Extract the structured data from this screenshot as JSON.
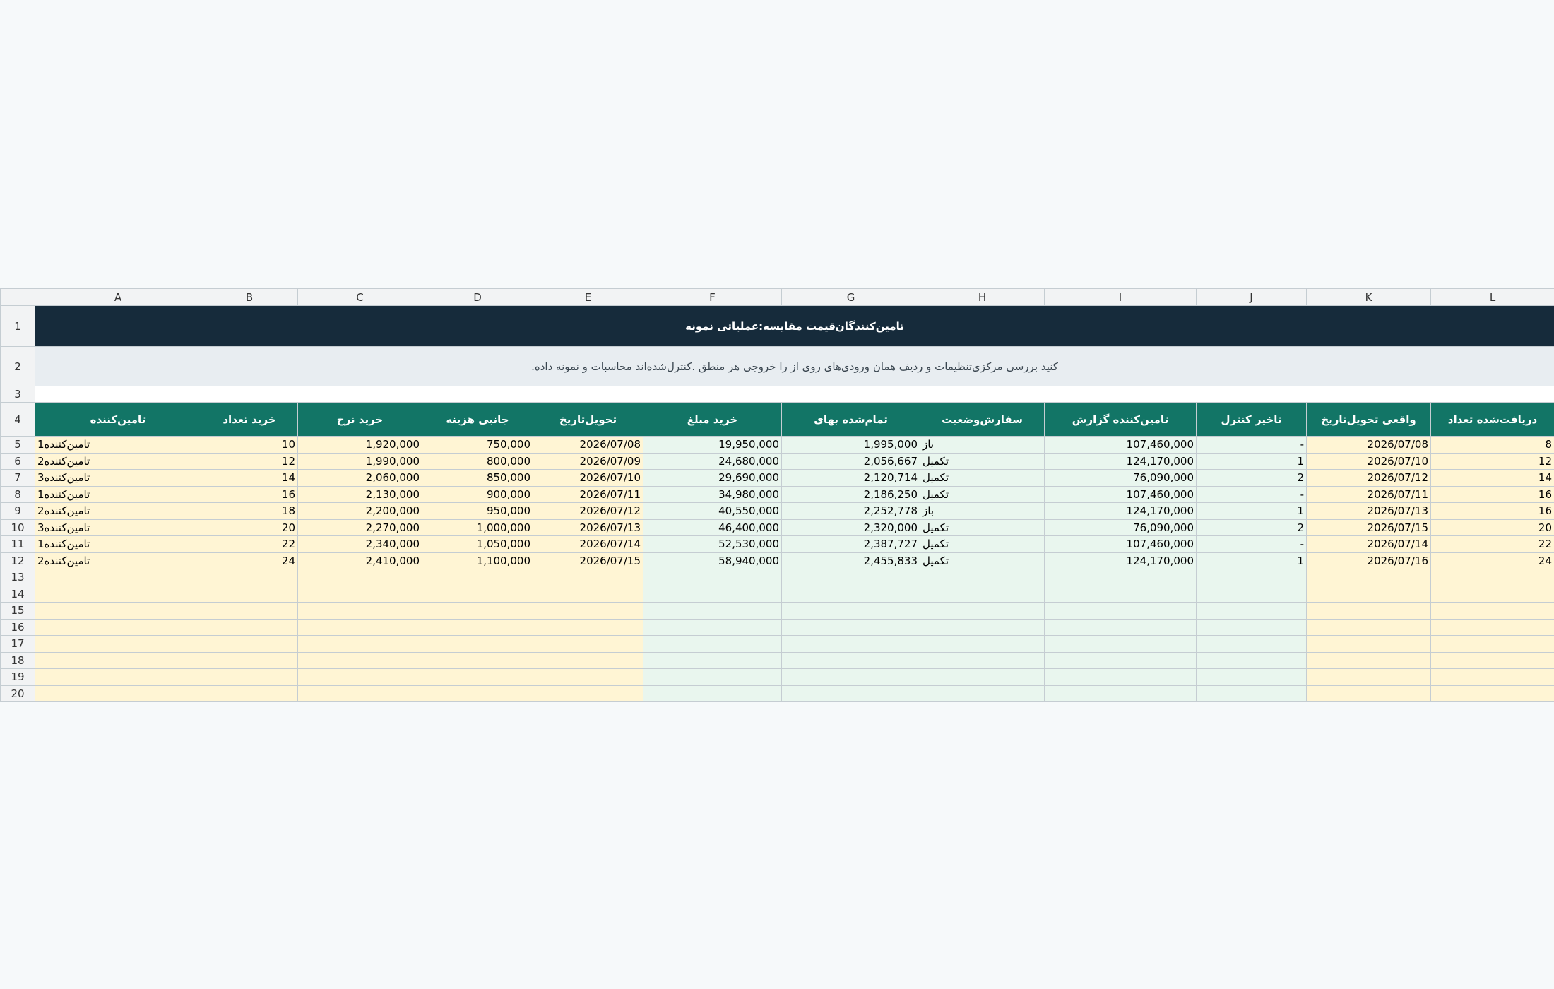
{
  "columns": [
    "A",
    "B",
    "C",
    "D",
    "E",
    "F",
    "G",
    "H",
    "I",
    "J",
    "K",
    "L"
  ],
  "title": "تامین‌کنندگان‌قیمت مقایسه:عملیاتی نمونه",
  "note": ".کنید بررسی مرکزی‌تنظیمات و ردیف همان ورودی‌های روی از را خروجی هر منطق .کنترل‌شده‌اند محاسبات و نمونه داده",
  "headers": [
    "تامین‌کننده",
    "خرید تعداد",
    "خرید نرخ",
    "جانبی هزینه",
    "تحویل‌تاریخ",
    "خرید مبلغ",
    "تمام‌شده بهای",
    "سفارش‌وضعیت",
    "تامین‌کننده گزارش",
    "تاخیر  کنترل",
    "واقعی تحویل‌تاریخ",
    "دریافت‌شده تعداد"
  ],
  "rows": [
    [
      "تامین‌کننده1",
      "10",
      "1,920,000",
      "750,000",
      "2026/07/08",
      "19,950,000",
      "1,995,000",
      "باز",
      "107,460,000",
      "-",
      "2026/07/08",
      "8"
    ],
    [
      "تامین‌کننده2",
      "12",
      "1,990,000",
      "800,000",
      "2026/07/09",
      "24,680,000",
      "2,056,667",
      "تکمیل",
      "124,170,000",
      "1",
      "2026/07/10",
      "12"
    ],
    [
      "تامین‌کننده3",
      "14",
      "2,060,000",
      "850,000",
      "2026/07/10",
      "29,690,000",
      "2,120,714",
      "تکمیل",
      "76,090,000",
      "2",
      "2026/07/12",
      "14"
    ],
    [
      "تامین‌کننده1",
      "16",
      "2,130,000",
      "900,000",
      "2026/07/11",
      "34,980,000",
      "2,186,250",
      "تکمیل",
      "107,460,000",
      "-",
      "2026/07/11",
      "16"
    ],
    [
      "تامین‌کننده2",
      "18",
      "2,200,000",
      "950,000",
      "2026/07/12",
      "40,550,000",
      "2,252,778",
      "باز",
      "124,170,000",
      "1",
      "2026/07/13",
      "16"
    ],
    [
      "تامین‌کننده3",
      "20",
      "2,270,000",
      "1,000,000",
      "2026/07/13",
      "46,400,000",
      "2,320,000",
      "تکمیل",
      "76,090,000",
      "2",
      "2026/07/15",
      "20"
    ],
    [
      "تامین‌کننده1",
      "22",
      "2,340,000",
      "1,050,000",
      "2026/07/14",
      "52,530,000",
      "2,387,727",
      "تکمیل",
      "107,460,000",
      "-",
      "2026/07/14",
      "22"
    ],
    [
      "تامین‌کننده2",
      "24",
      "2,410,000",
      "1,100,000",
      "2026/07/15",
      "58,940,000",
      "2,455,833",
      "تکمیل",
      "124,170,000",
      "1",
      "2026/07/16",
      "24"
    ]
  ],
  "row_numbers": [
    "1",
    "2",
    "3",
    "4",
    "5",
    "6",
    "7",
    "8",
    "9",
    "10",
    "11",
    "12",
    "13",
    "14",
    "15",
    "16",
    "17",
    "18",
    "19",
    "20"
  ],
  "colors": {
    "title_bg": "#162b3b",
    "header_bg": "#127566",
    "input_bg": "#fff5d4",
    "calc_bg": "#e9f6ee"
  }
}
